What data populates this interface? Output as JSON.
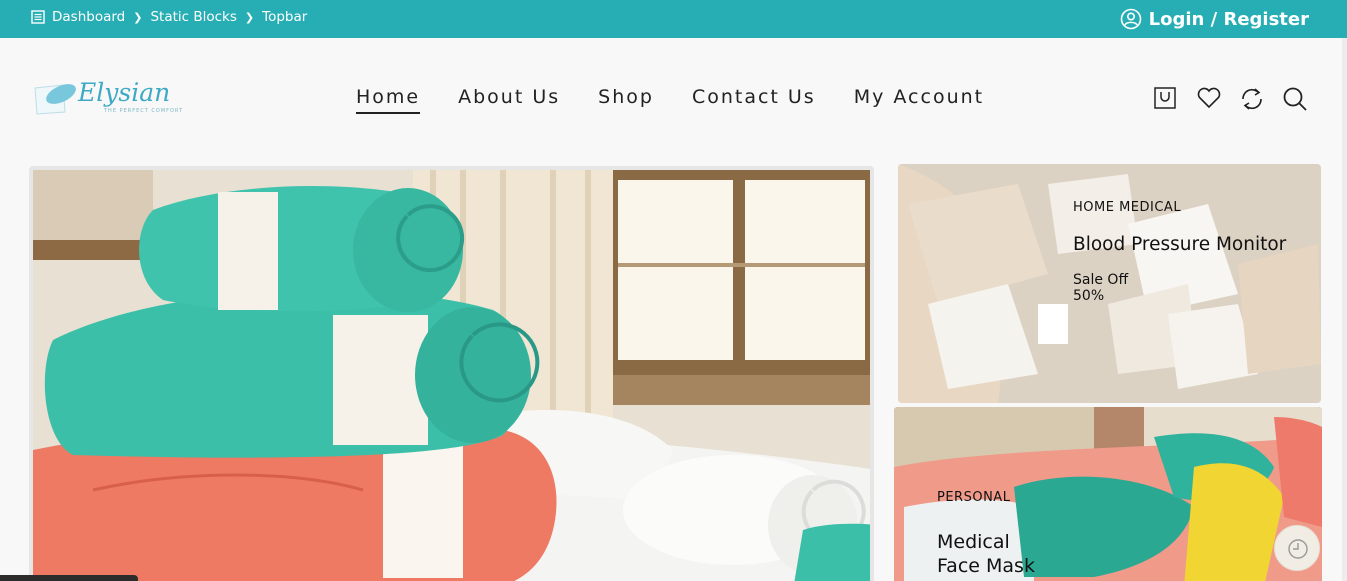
{
  "topbar": {
    "breadcrumb": [
      "Dashboard",
      "Static Blocks",
      "Topbar"
    ],
    "login_label": "Login / Register"
  },
  "logo": {
    "text": "Elysian",
    "tagline": "THE PERFECT COMFORT"
  },
  "nav": {
    "items": [
      "Home",
      "About Us",
      "Shop",
      "Contact Us",
      "My Account"
    ],
    "active": "Home"
  },
  "header_icons": [
    "cart-icon",
    "heart-icon",
    "compare-icon",
    "search-icon"
  ],
  "hero": {
    "image": "stack of teal and coral towels on white pillows by a window"
  },
  "banners": [
    {
      "category": "HOME MEDICAL",
      "title": "Blood Pressure Monitor",
      "sale_line1": "Sale Off",
      "sale_line2": "50%"
    },
    {
      "category": "PERSONAL",
      "title_line1": "Medical",
      "title_line2": "Face Mask"
    }
  ],
  "colors": {
    "topbar": "#27aeb4",
    "brand": "#3ea9c4",
    "text": "#222222",
    "teal_towel": "#3bbfa8",
    "coral_towel": "#ee7a63"
  }
}
